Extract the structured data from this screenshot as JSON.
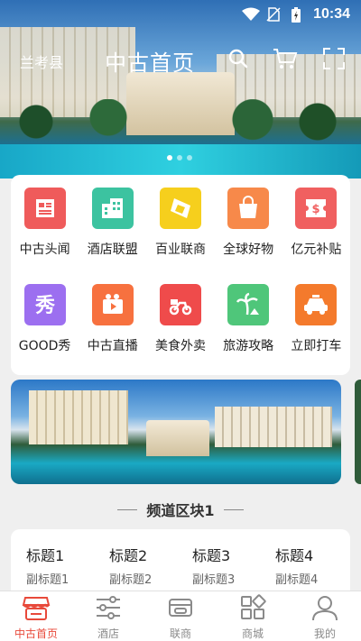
{
  "status_bar": {
    "time": "10:34"
  },
  "nav": {
    "location": "兰考县",
    "title": "中古首页"
  },
  "carousel": {
    "count": 3,
    "active": 0
  },
  "grid": [
    {
      "label": "中古头闻",
      "color": "#ef5b5b",
      "icon": "news-icon"
    },
    {
      "label": "酒店联盟",
      "color": "#3cc3a0",
      "icon": "building-icon"
    },
    {
      "label": "百业联商",
      "color": "#f6cf1d",
      "icon": "ticket-icon"
    },
    {
      "label": "全球好物",
      "color": "#f7894a",
      "icon": "bag-icon"
    },
    {
      "label": "亿元补贴",
      "color": "#f06060",
      "icon": "coupon-icon"
    },
    {
      "label": "GOOD秀",
      "color": "#9c6ff0",
      "icon": "show-icon"
    },
    {
      "label": "中古直播",
      "color": "#f7713f",
      "icon": "camera-icon"
    },
    {
      "label": "美食外卖",
      "color": "#ef4b4b",
      "icon": "scooter-icon"
    },
    {
      "label": "旅游攻略",
      "color": "#4fc67a",
      "icon": "palm-icon"
    },
    {
      "label": "立即打车",
      "color": "#f47a2c",
      "icon": "taxi-icon"
    }
  ],
  "section": {
    "title": "频道区块1"
  },
  "channels": [
    {
      "title": "标题1",
      "subtitle": "副标题1"
    },
    {
      "title": "标题2",
      "subtitle": "副标题2"
    },
    {
      "title": "标题3",
      "subtitle": "副标题3"
    },
    {
      "title": "标题4",
      "subtitle": "副标题4"
    }
  ],
  "tabs": [
    {
      "label": "中古首页",
      "icon": "store-icon",
      "active": true
    },
    {
      "label": "酒店",
      "icon": "sliders-icon",
      "active": false
    },
    {
      "label": "联商",
      "icon": "handshake-icon",
      "active": false
    },
    {
      "label": "商城",
      "icon": "grid-icon",
      "active": false
    },
    {
      "label": "我的",
      "icon": "user-icon",
      "active": false
    }
  ],
  "colors": {
    "accent": "#e8493a",
    "tab_inactive": "#8a8a8a"
  }
}
